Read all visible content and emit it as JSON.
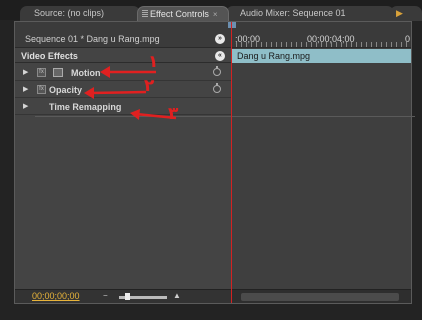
{
  "tabs": [
    {
      "label": "Source: (no clips)"
    },
    {
      "label": "Effect Controls",
      "close": "×"
    },
    {
      "label": "Audio Mixer: Sequence 01"
    },
    {
      "label": "▶"
    }
  ],
  "header": {
    "sequence_label": "Sequence 01 * Dang u Rang.mpg",
    "video_effects": "Video Effects",
    "jump_glyph": "»",
    "collapse_glyph": "«"
  },
  "effects": [
    {
      "name": "Motion",
      "fx": "fx"
    },
    {
      "name": "Opacity",
      "fx": "fx"
    },
    {
      "name": "Time Remapping",
      "fx": ""
    }
  ],
  "timeline": {
    "ruler_start": ";00;00",
    "ruler_mid": "00;00;04;00",
    "ruler_end": "0",
    "clip_name": "Dang u Rang.mpg"
  },
  "status": {
    "timecode": "00;00;00;00",
    "zoom_out": "−",
    "zoom_in": "▲"
  },
  "annotations": [
    "١",
    "٢",
    "٣"
  ],
  "colors": {
    "accent": "#e8b43a",
    "playhead": "#d22222",
    "clip": "#8fbec8",
    "annotation": "#e02020"
  }
}
